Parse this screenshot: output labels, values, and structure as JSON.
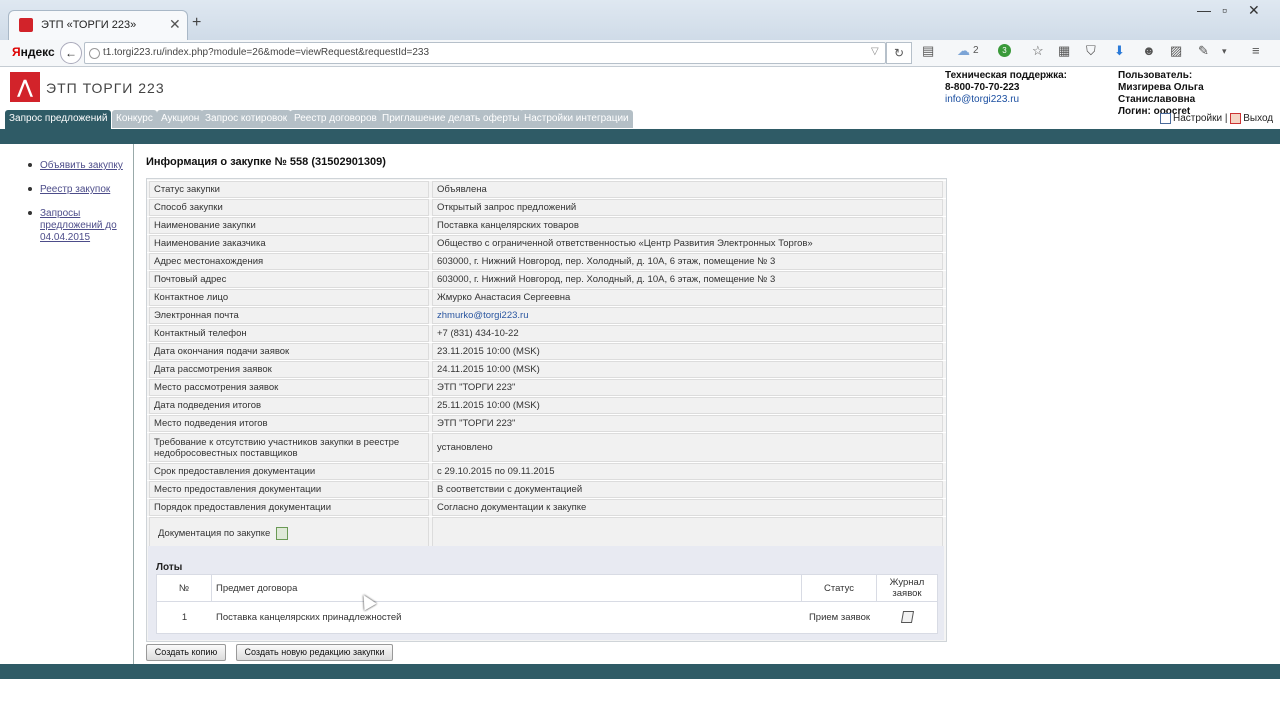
{
  "browser": {
    "tab_title": "ЭТП «ТОРГИ 223»",
    "new_tab": "+",
    "yandex_first": "Я",
    "yandex_rest": "ндекс",
    "url": "t1.torgi223.ru/index.php?module=26&mode=viewRequest&requestId=233",
    "cloud_count": "2",
    "badge_count": "3"
  },
  "site": {
    "logo_text": "ЭТП ТОРГИ 223",
    "support_title": "Техническая поддержка:",
    "support_phone": "8-800-70-70-223",
    "support_email": "info@torgi223.ru",
    "user_label": "Пользователь:",
    "user_name": "Мизгирева Ольга Станиславовна",
    "login_label": "Логин: ooocret",
    "settings": "Настройки",
    "separator": "|",
    "logout": "Выход"
  },
  "menu": [
    "Запрос предложений",
    "Конкурс",
    "Аукцион",
    "Запрос котировок",
    "Реестр договоров",
    "Приглашение делать оферты",
    "Настройки интеграции"
  ],
  "sidebar": [
    "Объявить закупку",
    "Реестр закупок",
    "Запросы предложений до 04.04.2015"
  ],
  "page_title": "Информация о закупке № 558 (31502901309)",
  "info_rows": [
    {
      "label": "Статус закупки",
      "value": "Объявлена"
    },
    {
      "label": "Способ закупки",
      "value": "Открытый запрос предложений"
    },
    {
      "label": "Наименование закупки",
      "value": "Поставка канцелярских товаров"
    },
    {
      "label": "Наименование заказчика",
      "value": "Общество с ограниченной ответственностью «Центр Развития Электронных Торгов»"
    },
    {
      "label": "Адрес местонахождения",
      "value": "603000, г. Нижний Новгород, пер. Холодный, д. 10А, 6 этаж, помещение № 3"
    },
    {
      "label": "Почтовый адрес",
      "value": "603000, г. Нижний Новгород, пер. Холодный, д. 10А, 6 этаж, помещение № 3"
    },
    {
      "label": "Контактное лицо",
      "value": "Жмурко Анастасия Сергеевна"
    },
    {
      "label": "Электронная почта",
      "value": "zhmurko@torgi223.ru"
    },
    {
      "label": "Контактный телефон",
      "value": "+7 (831) 434-10-22"
    },
    {
      "label": "Дата окончания подачи заявок",
      "value": "23.11.2015 10:00 (MSK)"
    },
    {
      "label": "Дата рассмотрения заявок",
      "value": "24.11.2015 10:00 (MSK)"
    },
    {
      "label": "Место рассмотрения заявок",
      "value": "ЭТП \"ТОРГИ 223\""
    },
    {
      "label": "Дата подведения итогов",
      "value": "25.11.2015 10:00 (MSK)"
    },
    {
      "label": "Место подведения итогов",
      "value": "ЭТП \"ТОРГИ 223\""
    },
    {
      "label": "Требование к отсутствию участников закупки в реестре недобросовестных поставщиков",
      "value": "установлено"
    },
    {
      "label": "Срок предоставления документации",
      "value": "с 29.10.2015 по 09.11.2015"
    },
    {
      "label": "Место предоставления документации",
      "value": "В соответствии с документацией"
    },
    {
      "label": "Порядок предоставления документации",
      "value": "Согласно документации к закупке"
    },
    {
      "label": "Документация по закупке",
      "value": ""
    }
  ],
  "lots": {
    "title": "Лоты",
    "headers": {
      "num": "№",
      "subject": "Предмет договора",
      "status": "Статус",
      "journal": "Журнал заявок"
    },
    "rows": [
      {
        "num": "1",
        "subject": "Поставка канцелярских принадлежностей",
        "status": "Прием заявок"
      }
    ]
  },
  "buttons": {
    "copy": "Создать копию",
    "new_edition": "Создать новую редакцию закупки"
  },
  "colors": {
    "brand_red": "#d2232a",
    "band": "#2f5b66",
    "menu_inactive": "#b4bfc6"
  }
}
